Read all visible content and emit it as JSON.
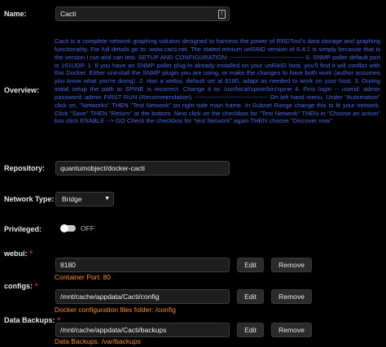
{
  "form": {
    "name": {
      "label": "Name:",
      "value": "Cacti",
      "badge": "!"
    },
    "overview": {
      "label": "Overview:",
      "text": "Cacti is a complete network graphing solution designed to harness the power of RRDTool's data storage and graphing functionality. For full details go to: www.cacti.net. The stated minium unRAID version of 6.4.1 is simply because that is the version I run and can test. SETUP AND CONFIGURATION: ------------------------------------ 0. SNMP poller default port is 161UDP. 1. If you have an SNMP poller plug-in already installed on your unRAID host, you'll find it will conflict with this Docker. Either uninstall the SNMP plugin you are using, or make the changes to have both work (author assumes you know what you're doing). 2. Has a webui, default set at 8180, adapt as needed to work on your host. 3. During initial setup the path to SPINE is incorrect. Change it to: /usr/local/spine/bin/spine 4. First login -- userid: admin password: admin FIRST RUN (Recommendation) ------------------------------------ On left hand menu, Under \"Automation\" click on, \"Networks\" THEN \"Test Network\" on right-side main frame. In Subnet Range change this to fit your network. Click \"Save\" THEN \"Return\" at the bottom. Next click on the checkbox for \"Test Network\" THEN in \"Choose an action\" box click ENABLE --> GO Check the checkbox for \"test Network\" again THEN choose \"Discover now\""
    },
    "repository": {
      "label": "Repository:",
      "value": "quantumobject/docker-cacti"
    },
    "network_type": {
      "label": "Network Type:",
      "selected": "Bridge",
      "caret": "▼"
    },
    "privileged": {
      "label": "Privileged:",
      "state_text": "OFF"
    },
    "webui": {
      "label": "webui:",
      "required_mark": "*",
      "value": "8180",
      "edit_label": "Edit",
      "remove_label": "Remove",
      "hint": "Container Port: 80"
    },
    "configs": {
      "label": "configs:",
      "required_mark": "*",
      "value": "/mnt/cache/appdata/Cacti/config",
      "edit_label": "Edit",
      "remove_label": "Remove",
      "hint": "Docker configuration files folder: /config"
    },
    "data_backups": {
      "label": "Data Backups:",
      "required_mark": "*",
      "value": "/mnt/cache/appdata/Cacti/backups",
      "edit_label": "Edit",
      "remove_label": "Remove",
      "hint": "Data Backups: /var/backups"
    }
  },
  "colors": {
    "background": "#000000",
    "overview_text": "#4466e6",
    "hint_text": "#ff8a1e",
    "required_mark": "#e22828"
  }
}
